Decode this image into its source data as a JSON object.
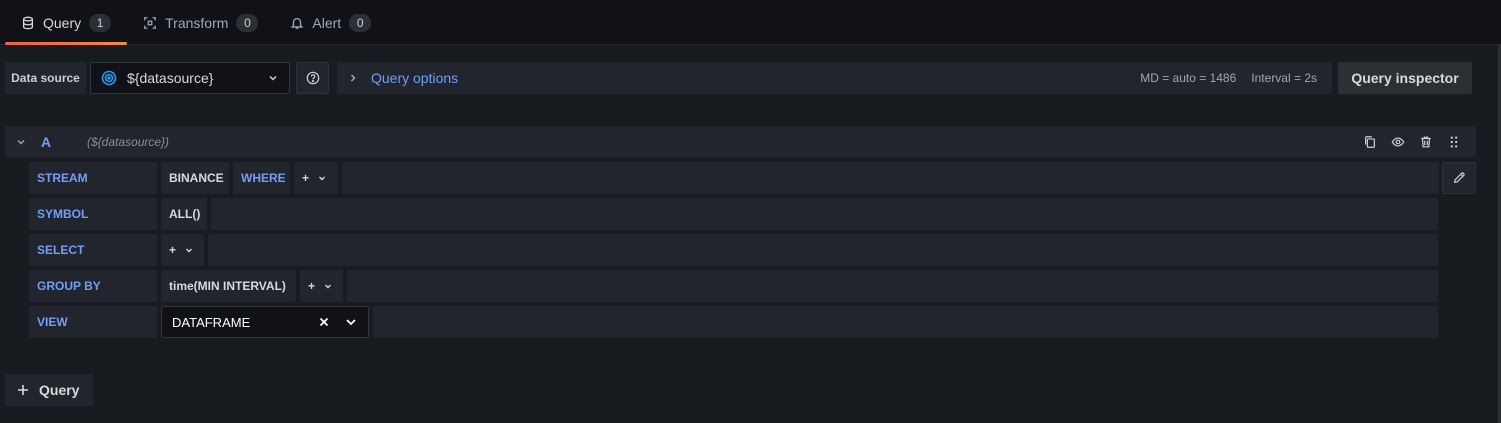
{
  "tabs": [
    {
      "label": "Query",
      "count": "1",
      "icon": "database-icon",
      "active": true
    },
    {
      "label": "Transform",
      "count": "0",
      "icon": "transform-icon",
      "active": false
    },
    {
      "label": "Alert",
      "count": "0",
      "icon": "bell-icon",
      "active": false
    }
  ],
  "datasource": {
    "label": "Data source",
    "value": "${datasource}",
    "options_label": "Query options",
    "md_info": "MD = auto = 1486",
    "interval_info": "Interval = 2s",
    "inspector_label": "Query inspector"
  },
  "query": {
    "ref_id": "A",
    "ds_name": "(${datasource})",
    "rows": {
      "stream": {
        "keyword": "STREAM",
        "value": "BINANCE",
        "where": "WHERE",
        "plus": "+"
      },
      "symbol": {
        "keyword": "SYMBOL",
        "value": "ALL()"
      },
      "select": {
        "keyword": "SELECT",
        "plus": "+"
      },
      "group_by": {
        "keyword": "GROUP BY",
        "value": "time(MIN INTERVAL)",
        "plus": "+"
      },
      "view": {
        "keyword": "VIEW",
        "value": "DATAFRAME"
      }
    }
  },
  "add_query_label": "Query",
  "colors": {
    "accent": "#6e9fff",
    "active_tab": "#f55f3e",
    "background": "#181b1f"
  }
}
